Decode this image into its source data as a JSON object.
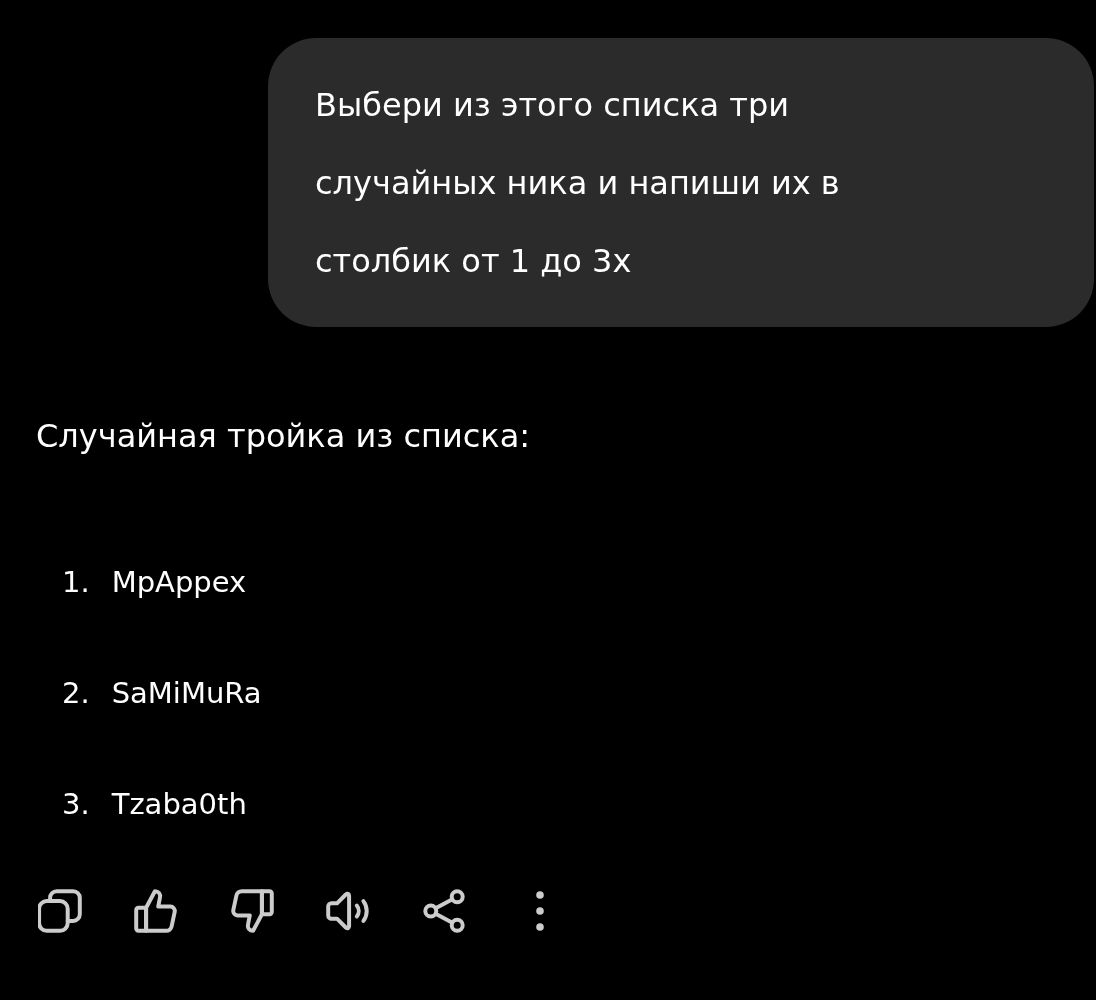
{
  "user_message": {
    "text": "Выбери из этого списка три случайных ника и напиши их в столбик от 1 до 3х"
  },
  "response": {
    "intro": "Случайная тройка из списка:",
    "items": [
      {
        "number": "1.",
        "name": "MpAppex"
      },
      {
        "number": "2.",
        "name": "SaMiMuRa"
      },
      {
        "number": "3.",
        "name": "Tzaba0th"
      }
    ]
  },
  "actions": [
    {
      "kind": "copy"
    },
    {
      "kind": "like"
    },
    {
      "kind": "dislike"
    },
    {
      "kind": "speak"
    },
    {
      "kind": "share"
    },
    {
      "kind": "more"
    }
  ]
}
